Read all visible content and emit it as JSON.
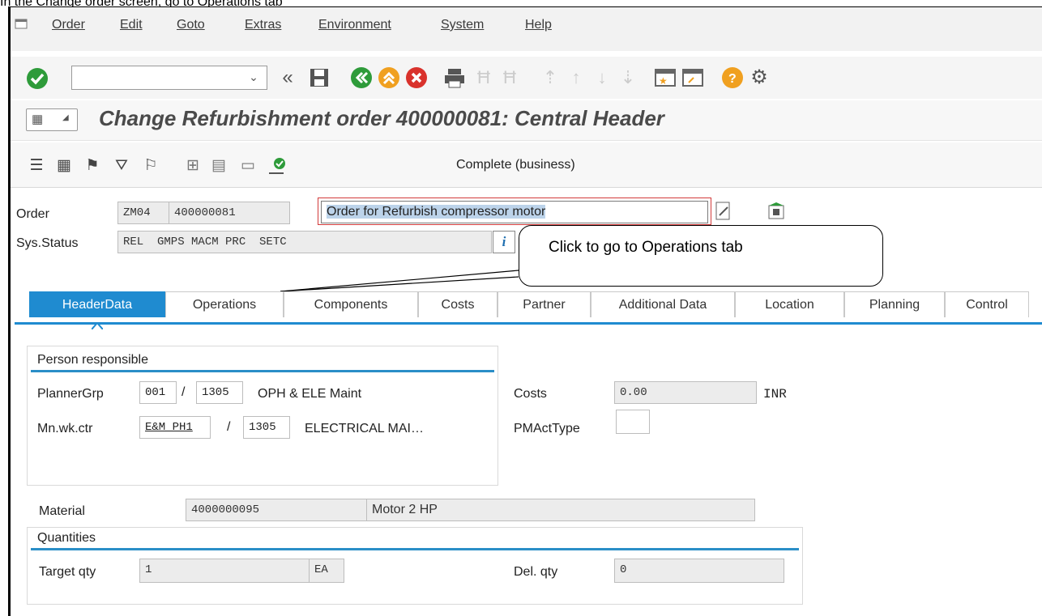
{
  "caption": "In the Change order screen, go to Operations tab",
  "menu": [
    "Order",
    "Edit",
    "Goto",
    "Extras",
    "Environment",
    "System",
    "Help"
  ],
  "window_title": "Change Refurbishment order 400000081: Central Header",
  "app_toolbar": {
    "complete_label": "Complete (business)"
  },
  "icons": {
    "enter": "green-check-icon",
    "save": "save-icon",
    "back": "back-icon",
    "exit": "exit-icon",
    "cancel": "cancel-icon",
    "print": "print-icon",
    "find": "find-icon",
    "help": "help-icon",
    "settings": "settings-icon"
  },
  "header": {
    "order_label": "Order",
    "order_type": "ZM04",
    "order_number": "400000081",
    "order_description": "Order for Refurbish compressor motor",
    "sys_status_label": "Sys.Status",
    "sys_status_value": "REL  GMPS MACM PRC  SETC",
    "info_button": "i"
  },
  "callout": {
    "text": "Click to go to Operations tab"
  },
  "tabs": [
    "HeaderData",
    "Operations",
    "Components",
    "Costs",
    "Partner",
    "Additional Data",
    "Location",
    "Planning",
    "Control"
  ],
  "active_tab": "HeaderData",
  "person_responsible": {
    "title": "Person responsible",
    "planner_grp_label": "PlannerGrp",
    "planner_grp": "001",
    "planner_plant": "1305",
    "planner_text": "OPH & ELE Maint",
    "separator": "/",
    "main_wkctr_label": "Mn.wk.ctr",
    "main_wkctr": "E&M_PH1",
    "main_wkctr_plant": "1305",
    "main_wkctr_text": "ELECTRICAL MAI…"
  },
  "costs": {
    "label": "Costs",
    "value": "0.00",
    "currency": "INR"
  },
  "pm_act_type": {
    "label": "PMActType",
    "value": ""
  },
  "material": {
    "label": "Material",
    "number": "4000000095",
    "description": "Motor 2 HP"
  },
  "quantities": {
    "title": "Quantities",
    "target_label": "Target qty",
    "target_value": "1",
    "unit": "EA",
    "delivered_label": "Del. qty",
    "delivered_value": "0"
  },
  "colors": {
    "accent": "#1f8bd0",
    "green": "#2e9b3a",
    "orange": "#f0a020",
    "red": "#d9322c"
  }
}
